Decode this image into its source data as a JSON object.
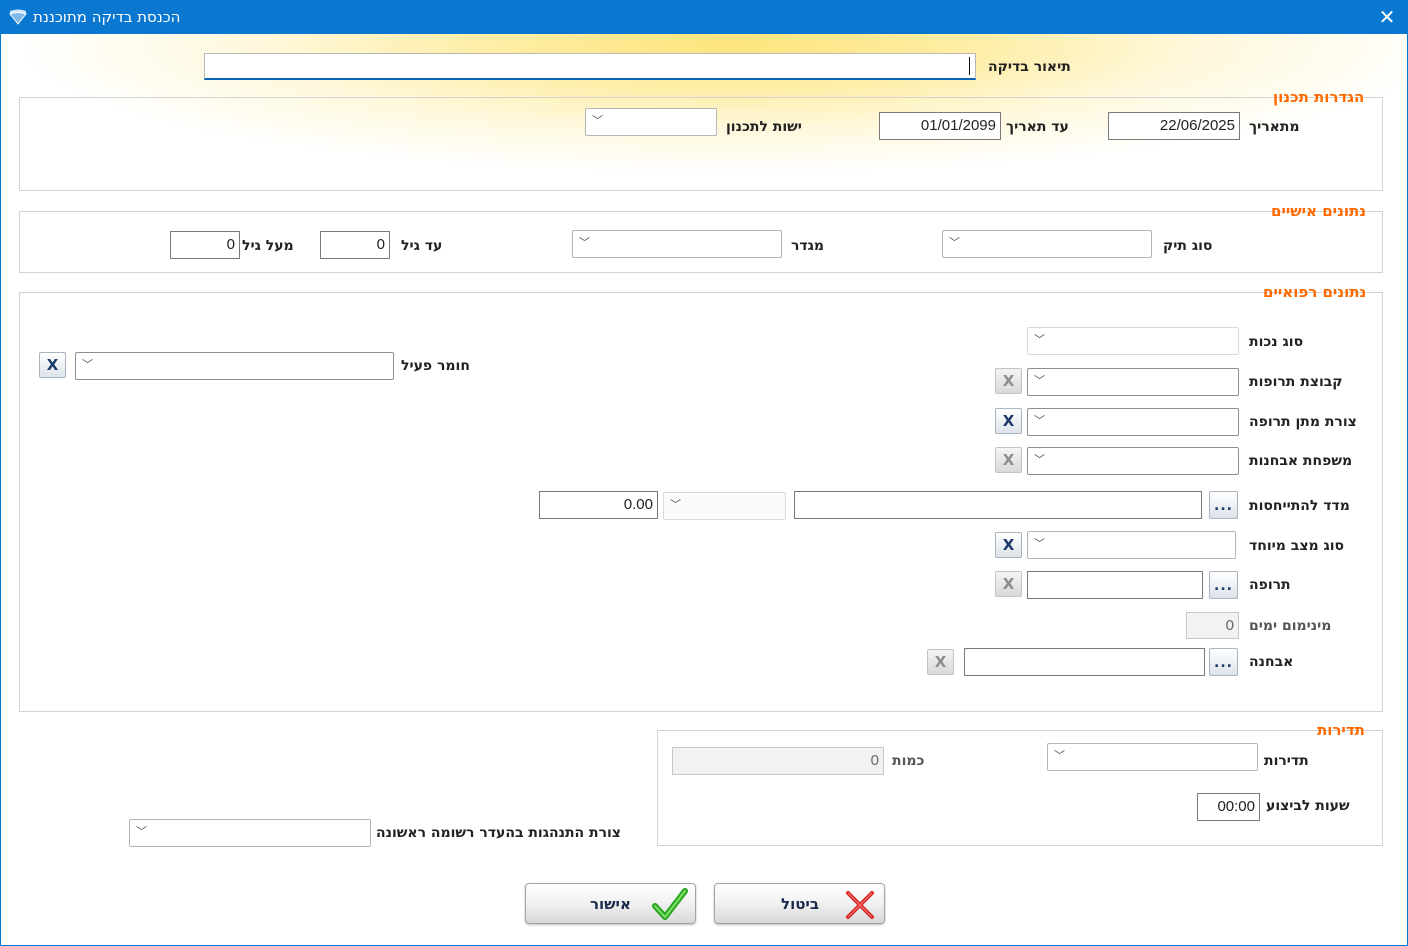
{
  "window": {
    "title": "הכנסת בדיקה מתוכננת",
    "close_glyph": "✕"
  },
  "header": {
    "test_description_label": "תיאור בדיקה",
    "test_description_value": ""
  },
  "planning": {
    "title": "הגדרות תכנון",
    "from_date_label": "מתאריך",
    "from_date_value": "22/06/2025",
    "to_date_label": "עד תאריך",
    "to_date_value": "01/01/2099",
    "entity_label": "ישות לתכנון",
    "entity_value": ""
  },
  "personal": {
    "title": "נתונים אישיים",
    "file_type_label": "סוג תיק",
    "file_type_value": "",
    "gender_label": "מגדר",
    "gender_value": "",
    "to_age_label": "עד גיל",
    "to_age_value": "0",
    "above_age_label": "מעל גיל",
    "above_age_value": "0"
  },
  "medical": {
    "title": "נתונים רפואיים",
    "disability_type_label": "סוג נכות",
    "drug_group_label": "קבוצת תרופות",
    "drug_form_label": "צורת מתן תרופה",
    "diagnosis_family_label": "משפחת אבחנות",
    "reference_index_label": "מדד להתייחסות",
    "reference_value": "0.00",
    "special_state_label": "סוג מצב מיוחד",
    "medication_label": "תרופה",
    "min_days_label": "מינימום ימים",
    "min_days_value": "0",
    "diagnosis_label": "אבחנה",
    "active_ingredient_label": "חומר פעיל",
    "clear_glyph": "X",
    "browse_glyph": "..."
  },
  "frequency": {
    "title": "תדירות",
    "frequency_label": "תדירות",
    "frequency_value": "",
    "quantity_label": "כמות",
    "quantity_value": "0",
    "exec_hours_label": "שעות לביצוע",
    "exec_hours_value": "00:00"
  },
  "behavior": {
    "label": "צורת התנהגות בהעדר רשומה ראשונה",
    "value": ""
  },
  "actions": {
    "confirm_label": "אישור",
    "cancel_label": "ביטול"
  },
  "colors": {
    "titlebar": "#0a78d0",
    "group_title": "#ff6a00",
    "accent": "#0a64b4"
  }
}
